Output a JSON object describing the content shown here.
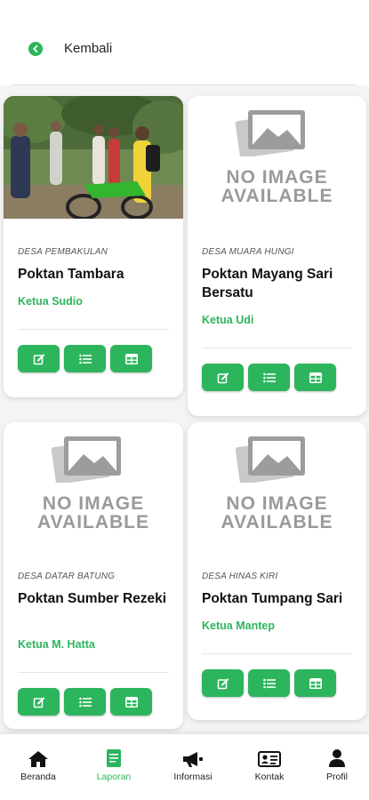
{
  "header": {
    "back_label": "Kembali"
  },
  "no_image": {
    "line1": "NO IMAGE",
    "line2": "AVAILABLE"
  },
  "cards": [
    {
      "desa": "DESA PEMBAKULAN",
      "title": "Poktan Tambara",
      "ketua": "Ketua Sudio",
      "image": "photo"
    },
    {
      "desa": "DESA MUARA HUNGI",
      "title": "Poktan Mayang Sari Bersatu",
      "ketua": "Ketua Udi",
      "image": "no-image-available"
    },
    {
      "desa": "DESA DATAR BATUNG",
      "title": "Poktan Sumber Rezeki",
      "ketua": "Ketua M. Hatta",
      "image": "no-image-available"
    },
    {
      "desa": "DESA HINAS KIRI",
      "title": "Poktan Tumpang Sari",
      "ketua": "Ketua Mantep",
      "image": "no-image-available"
    }
  ],
  "card_actions": [
    "edit-icon",
    "list-icon",
    "table-icon"
  ],
  "nav": {
    "items": [
      {
        "label": "Beranda",
        "icon": "home-icon"
      },
      {
        "label": "Laporan",
        "icon": "report-icon",
        "active": true
      },
      {
        "label": "Informasi",
        "icon": "megaphone-icon"
      },
      {
        "label": "Kontak",
        "icon": "contact-card-icon"
      },
      {
        "label": "Profil",
        "icon": "user-icon"
      }
    ]
  },
  "colors": {
    "accent": "#2db55d",
    "background": "#f4f4f4",
    "card": "#ffffff"
  }
}
